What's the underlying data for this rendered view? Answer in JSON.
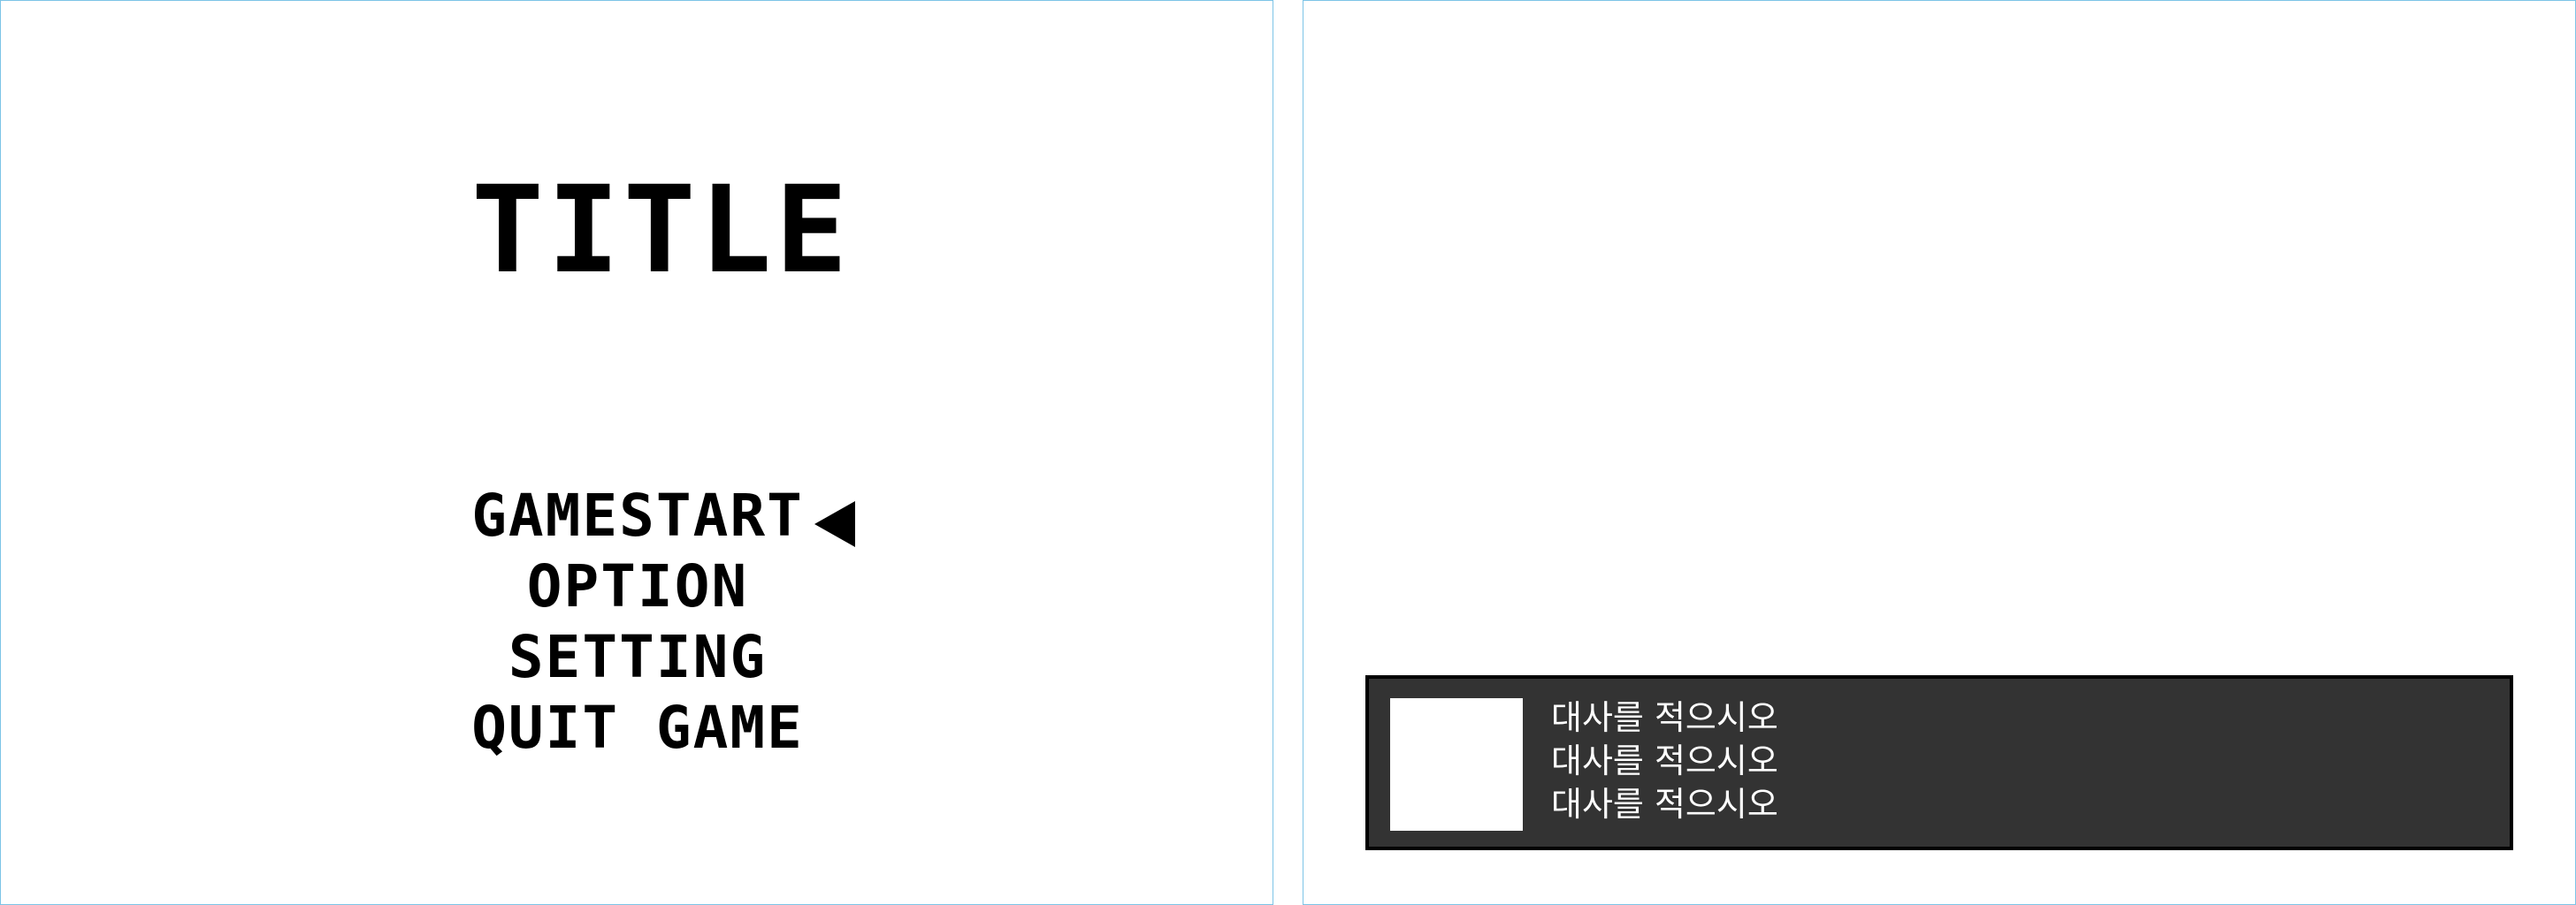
{
  "title_screen": {
    "title": "TITLE",
    "menu": [
      {
        "label": "GAMESTART",
        "selected": true
      },
      {
        "label": "OPTION",
        "selected": false
      },
      {
        "label": "SETTING",
        "selected": false
      },
      {
        "label": "QUIT GAME",
        "selected": false
      }
    ],
    "selection_cursor_icon": "triangle-left-icon"
  },
  "dialog_screen": {
    "portrait_icon": "portrait-placeholder",
    "lines": [
      "대사를 적으시오",
      "대사를 적으시오",
      "대사를 적으시오"
    ]
  },
  "colors": {
    "panel_border": "#7cc4e6",
    "dialog_background": "#333333",
    "dialog_text": "#ffffff",
    "title_text": "#000000"
  }
}
